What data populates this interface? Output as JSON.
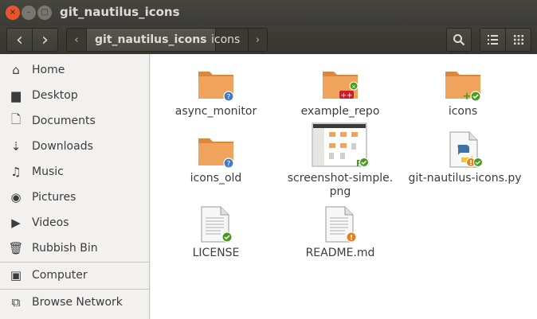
{
  "window": {
    "title": "git_nautilus_icons"
  },
  "titlebar_buttons": {
    "close": "×",
    "minimize": "–",
    "maximize": "□"
  },
  "toolbar": {
    "back": "‹",
    "forward": "›",
    "crumb_left": "‹",
    "crumb_right": "›",
    "breadcrumbs": [
      "git_nautilus_icons",
      "icons"
    ],
    "search_icon": "search-icon",
    "list_view_icon": "list-view-icon",
    "grid_view_icon": "grid-view-icon"
  },
  "sidebar": {
    "items": [
      {
        "label": "Home",
        "icon": "⌂"
      },
      {
        "label": "Desktop",
        "icon": "▆"
      },
      {
        "label": "Documents",
        "icon": "🗋"
      },
      {
        "label": "Downloads",
        "icon": "⇣"
      },
      {
        "label": "Music",
        "icon": "♫"
      },
      {
        "label": "Pictures",
        "icon": "◉"
      },
      {
        "label": "Videos",
        "icon": "▶"
      },
      {
        "label": "Rubbish Bin",
        "icon": "🗑"
      },
      {
        "label": "Computer",
        "icon": "▣"
      },
      {
        "label": "Browse Network",
        "icon": "⧉"
      }
    ]
  },
  "files": [
    {
      "label": "async_monitor",
      "type": "folder",
      "emblem": "unknown"
    },
    {
      "label": "example_repo",
      "type": "folder",
      "emblem": "repo"
    },
    {
      "label": "icons",
      "type": "folder",
      "emblem": "added-clean"
    },
    {
      "label": "icons_old",
      "type": "folder",
      "emblem": "unknown"
    },
    {
      "label": "screenshot-simple.\npng",
      "type": "image",
      "emblem": "renamed-clean"
    },
    {
      "label": "git-nautilus-icons.py",
      "type": "python",
      "emblem": "modified"
    },
    {
      "label": "LICENSE",
      "type": "text",
      "emblem": "clean"
    },
    {
      "label": "README.md",
      "type": "text",
      "emblem": "modified"
    }
  ],
  "colors": {
    "folder": "#f0a35c",
    "emblem_clean": "#4a9a20",
    "emblem_unknown": "#3d7cc9",
    "emblem_modified": "#e8801a",
    "emblem_repo": "#c8202a"
  }
}
